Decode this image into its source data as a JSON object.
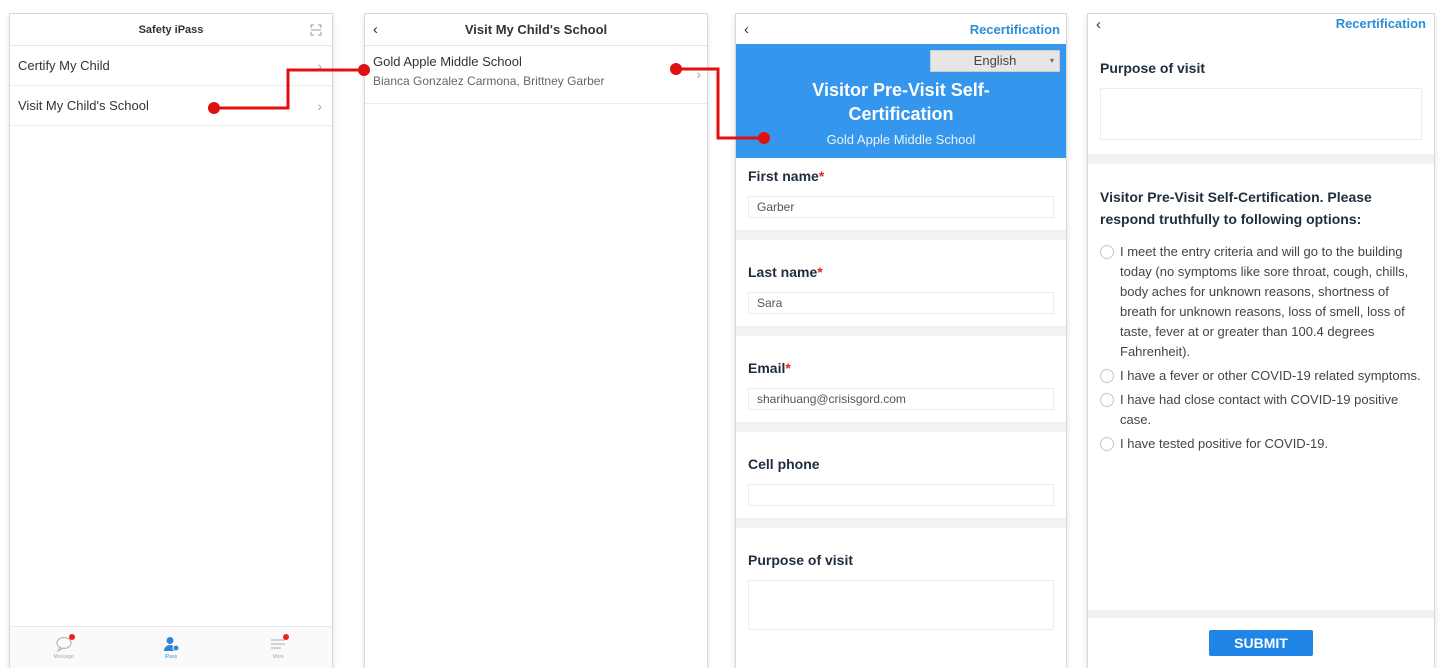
{
  "screen1": {
    "title": "Safety iPass",
    "menu": [
      {
        "label": "Certify My Child"
      },
      {
        "label": "Visit My Child's School"
      }
    ],
    "tabs": [
      {
        "label": "Message",
        "icon": "message-icon"
      },
      {
        "label": "iPass",
        "icon": "ipass-icon"
      },
      {
        "label": "More",
        "icon": "more-icon"
      }
    ]
  },
  "screen2": {
    "title": "Visit My Child's School",
    "school_name": "Gold Apple Middle School",
    "children": "Bianca Gonzalez Carmona, Brittney Garber"
  },
  "screen3": {
    "recertification": "Recertification",
    "language": "English",
    "banner_title": "Visitor Pre-Visit Self-Certification",
    "banner_school": "Gold Apple Middle School",
    "fields": {
      "first_name_label": "First name",
      "first_name_value": "Garber",
      "last_name_label": "Last name",
      "last_name_value": "Sara",
      "email_label": "Email",
      "email_value": "sharihuang@crisisgord.com",
      "cell_label": "Cell phone",
      "cell_value": "",
      "purpose_label": "Purpose of visit"
    },
    "required_mark": "*"
  },
  "screen4": {
    "recertification": "Recertification",
    "purpose_label": "Purpose of visit",
    "question": "Visitor Pre-Visit Self-Certification. Please respond truthfully to following options:",
    "options": [
      "I meet the entry criteria and will go to the building today (no symptoms like sore throat, cough, chills, body aches for unknown reasons, shortness of breath for unknown reasons, loss of smell, loss of taste, fever at or greater than 100.4 degrees Fahrenheit).",
      "I have a fever or other COVID-19 related symptoms.",
      "I have had close contact with COVID-19 positive case.",
      "I have tested positive for COVID-19."
    ],
    "submit": "SUBMIT"
  },
  "colors": {
    "accent": "#3596ee",
    "connector": "#e01010",
    "link": "#2b8fd6"
  }
}
